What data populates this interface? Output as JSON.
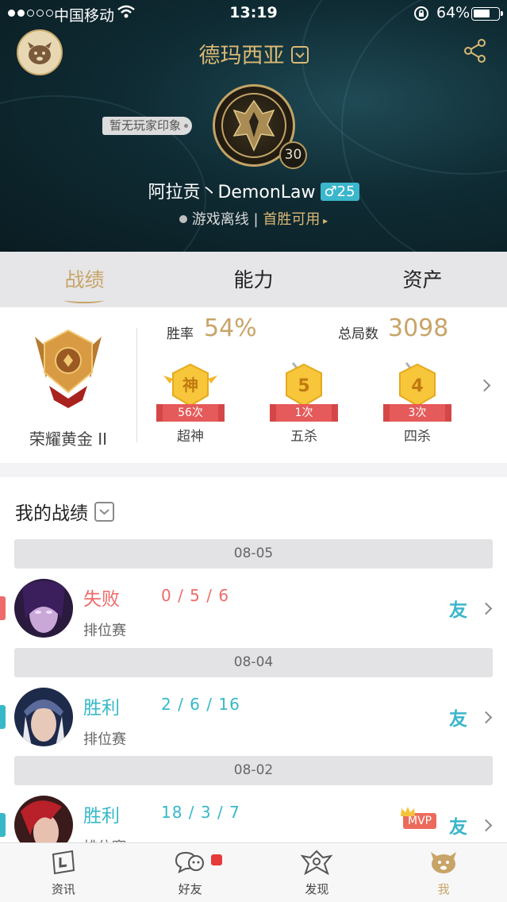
{
  "status_bar": {
    "carrier": "中国移动",
    "time": "13:19",
    "battery": "64%"
  },
  "header": {
    "server": "德玛西亚",
    "impression_tag": "暂无玩家印象",
    "level": "30",
    "player_name": "阿拉贡丶DemonLaw",
    "gender_age": "♂25",
    "online_status": "游戏离线",
    "separator": "|",
    "first_win": "首胜可用"
  },
  "tabs": [
    {
      "label": "战绩",
      "active": true
    },
    {
      "label": "能力",
      "active": false
    },
    {
      "label": "资产",
      "active": false
    }
  ],
  "rank": {
    "tier": "荣耀黄金 II",
    "win_rate_label": "胜率",
    "win_rate": "54%",
    "total_games_label": "总局数",
    "total_games": "3098",
    "honors": [
      {
        "glyph": "神",
        "count": "56次",
        "name": "超神"
      },
      {
        "glyph": "5",
        "count": "1次",
        "name": "五杀"
      },
      {
        "glyph": "4",
        "count": "3次",
        "name": "四杀"
      }
    ]
  },
  "matches_section": {
    "title": "我的战绩",
    "items": [
      {
        "date": "08-05",
        "result": "失败",
        "outcome": "lose",
        "kda": "0 / 5 / 6",
        "mode": "排位赛",
        "friend": "友",
        "mvp": ""
      },
      {
        "date": "08-04",
        "result": "胜利",
        "outcome": "win",
        "kda": "2 / 6 / 16",
        "mode": "排位赛",
        "friend": "友",
        "mvp": ""
      },
      {
        "date": "08-02",
        "result": "胜利",
        "outcome": "win",
        "kda": "18 / 3 / 7",
        "mode": "排位赛",
        "friend": "友",
        "mvp": "MVP"
      }
    ]
  },
  "bottom_nav": [
    {
      "label": "资讯",
      "icon": "news-icon"
    },
    {
      "label": "好友",
      "icon": "friends-icon"
    },
    {
      "label": "发现",
      "icon": "discover-icon"
    },
    {
      "label": "我",
      "icon": "me-icon"
    }
  ],
  "colors": {
    "gold": "#c8a468",
    "win": "#37b8c9",
    "lose": "#ef6a6a",
    "header_bg": "#0f2b33"
  }
}
